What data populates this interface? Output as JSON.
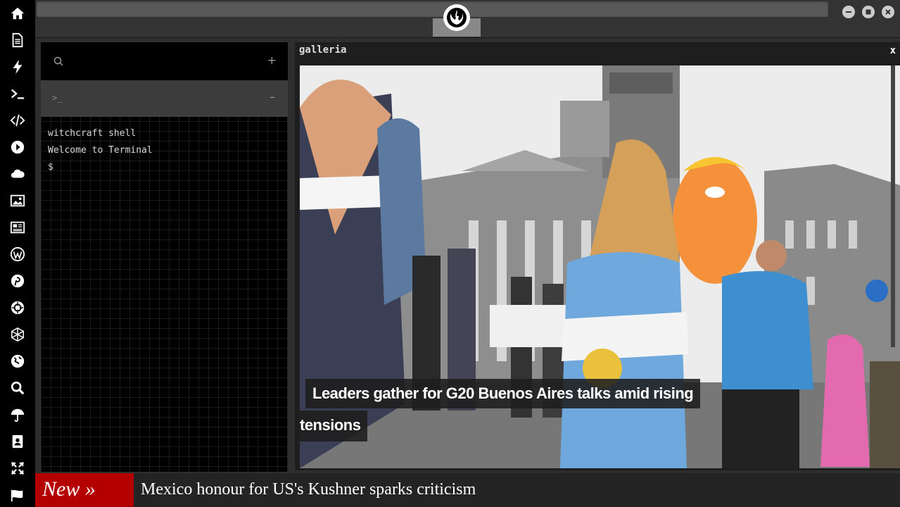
{
  "sidebar": {
    "icons": [
      "home-icon",
      "document-icon",
      "bolt-icon",
      "terminal-icon",
      "code-icon",
      "play-icon",
      "cloud-icon",
      "image-icon",
      "newspaper-icon",
      "wordpress-icon",
      "pinterest-icon",
      "settings-icon",
      "network-icon",
      "globe-icon",
      "search-icon",
      "umbrella-icon",
      "contacts-icon",
      "expand-icon",
      "flag-icon"
    ]
  },
  "terminal": {
    "prompt_glyph": ">_",
    "plus": "+",
    "minus": "–",
    "lines": [
      "witchcraft shell",
      "Welcome to Terminal",
      "$"
    ]
  },
  "galleria": {
    "title": "galleria",
    "close": "x",
    "caption_line1": "Leaders gather for G20 Buenos Aires talks amid rising",
    "caption_line2": "tensions"
  },
  "ticker": {
    "badge": "New »",
    "headline": "Mexico honour for US's Kushner sparks criticism"
  },
  "colors": {
    "sidebar_bg": "#000000",
    "ticker_badge": "#b40000",
    "panel_bg": "#1e1e1e"
  }
}
